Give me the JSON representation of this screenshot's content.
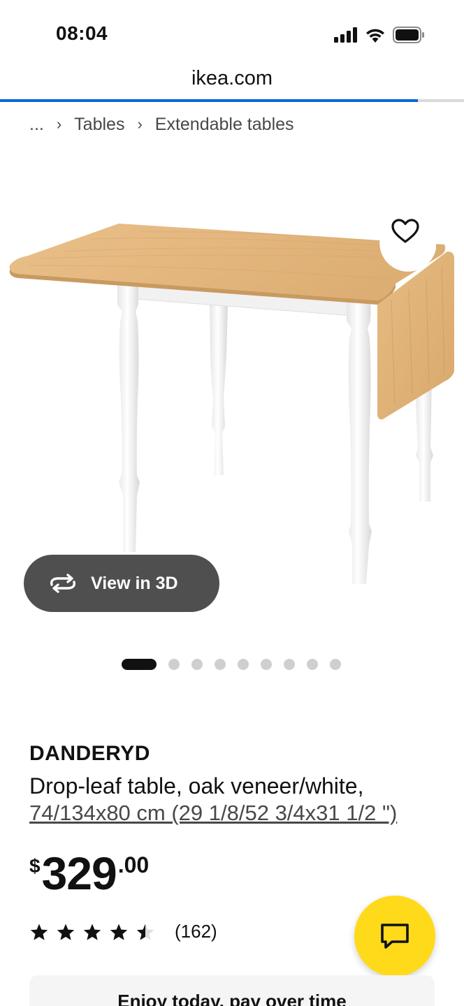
{
  "status": {
    "time": "08:04",
    "icons": [
      "signal-icon",
      "wifi-icon",
      "battery-icon"
    ]
  },
  "browser": {
    "url": "ikea.com",
    "load_progress_percent": 90
  },
  "breadcrumb": {
    "ellipsis": "...",
    "items": [
      "Tables",
      "Extendable tables"
    ]
  },
  "gallery": {
    "view3d_label": "View in 3D",
    "image_count": 9,
    "active_index": 0
  },
  "product": {
    "name": "DANDERYD",
    "description": "Drop-leaf table, oak veneer/white,",
    "dimensions": "74/134x80 cm (29 1/8/52 3/4x31 1/2 \")"
  },
  "price": {
    "currency": "$",
    "integer": "329",
    "decimal": ".00"
  },
  "rating": {
    "stars": 4.5,
    "count": "(162)"
  },
  "finance": {
    "text": "Enjoy today, pay over time"
  },
  "colors": {
    "accent_blue": "#0a66d8",
    "chat_yellow": "#ffda1a",
    "dark_pill": "#4f4f4f"
  }
}
